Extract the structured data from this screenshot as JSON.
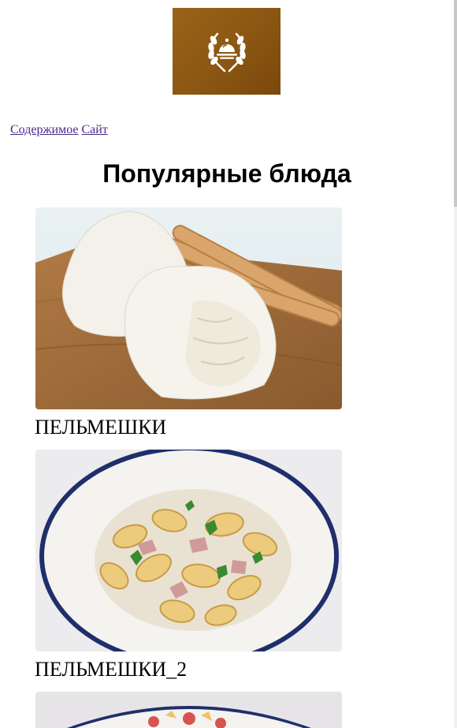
{
  "nav": {
    "link_contents": "Содержимое",
    "link_site": "Сайт"
  },
  "page": {
    "title": "Популярные блюда"
  },
  "dishes": [
    {
      "name": "ПЕЛЬМЕШКИ",
      "image_icon": "burrata-photo"
    },
    {
      "name": "ПЕЛЬМЕШКИ_2",
      "image_icon": "pasta-bowl-photo"
    },
    {
      "image_icon": "dessert-photo"
    }
  ],
  "colors": {
    "brand": "#8a5612",
    "link": "#4b2b8a"
  }
}
